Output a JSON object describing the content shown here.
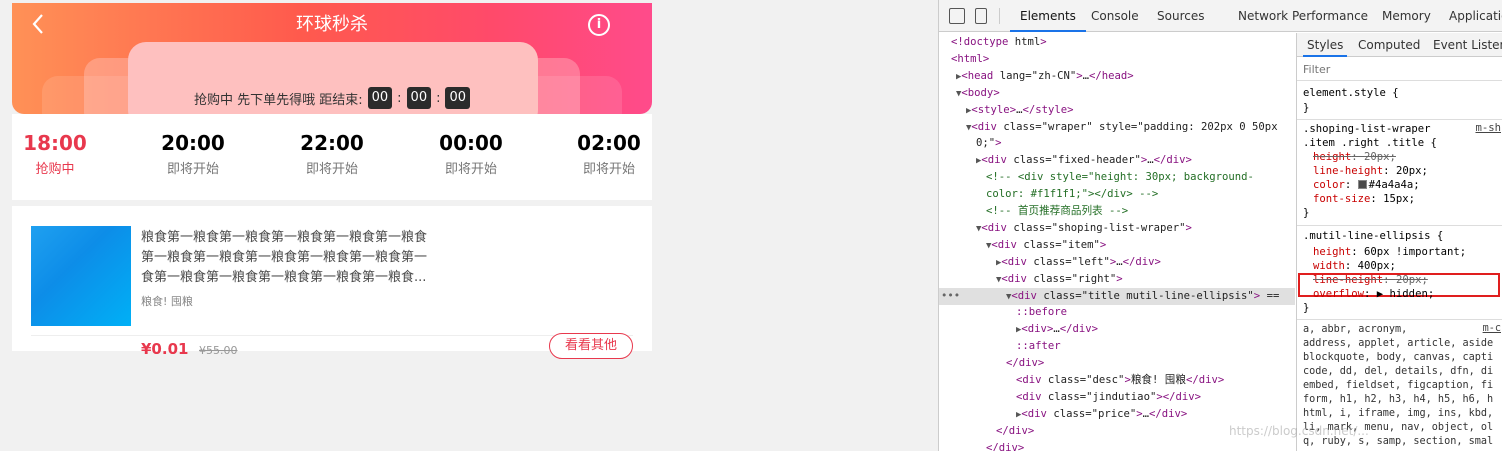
{
  "page": {
    "header": {
      "title": "环球秒杀",
      "back_icon": "chevron-left-icon",
      "info_icon": "info-icon"
    },
    "countdown": {
      "label": "抢购中 先下单先得哦 距结束:",
      "hours": "00",
      "minutes": "00",
      "seconds": "00",
      "separator": ":"
    },
    "time_slots": [
      {
        "time": "18:00",
        "status": "抢购中",
        "active": true
      },
      {
        "time": "20:00",
        "status": "即将开始",
        "active": false
      },
      {
        "time": "22:00",
        "status": "即将开始",
        "active": false
      },
      {
        "time": "00:00",
        "status": "即将开始",
        "active": false
      },
      {
        "time": "02:00",
        "status": "即将开始",
        "active": false
      }
    ],
    "product": {
      "title_lines": [
        "粮食第一粮食第一粮食第一粮食第一粮食第一粮食",
        "第一粮食第一粮食第一粮食第一粮食第一粮食第一",
        "食第一粮食第一粮食第一粮食第一粮食第一粮食..."
      ],
      "desc": "粮食! 囤粮",
      "price": "¥0.01",
      "old_price": "¥55.00",
      "button": "看看其他"
    },
    "colors": {
      "accent": "#e8384d",
      "header_start": "#ff9156",
      "header_end": "#ff4b8b"
    }
  },
  "devtools": {
    "tabs": [
      "Elements",
      "Console",
      "Sources",
      "Network",
      "Performance",
      "Memory",
      "Applicatio"
    ],
    "active_tab": "Elements",
    "dom_lines": [
      {
        "t": "<!doctype html>"
      },
      {
        "t": "<html>"
      },
      {
        "t": "▶<head lang=\"zh-CN\">…</head>"
      },
      {
        "t": "▼<body>"
      },
      {
        "t": "▶<style>…</style>"
      },
      {
        "t": "▼<div class=\"wraper\" style=\"padding: 202px 0 50px"
      },
      {
        "t": "0;\">"
      },
      {
        "t": "▶<div class=\"fixed-header\">…</div>"
      },
      {
        "t": "<!-- <div style=\"height: 30px; background-"
      },
      {
        "t": "color: #f1f1f1;\"></div> -->"
      },
      {
        "t": "<!-- 首页推荐商品列表 -->"
      },
      {
        "t": "▼<div class=\"shoping-list-wraper\">"
      },
      {
        "t": "▼<div class=\"item\">"
      },
      {
        "t": "▶<div class=\"left\">…</div>"
      },
      {
        "t": "▼<div class=\"right\">"
      },
      {
        "t": "▼<div class=\"title mutil-line-ellipsis\"> =="
      },
      {
        "t": "::before"
      },
      {
        "t": "▶<div>…</div>"
      },
      {
        "t": "::after"
      },
      {
        "t": "</div>"
      },
      {
        "t": "<div class=\"desc\">粮食! 囤粮</div>"
      },
      {
        "t": "<div class=\"jindutiao\"></div>"
      },
      {
        "t": "▶<div class=\"price\">…</div>"
      },
      {
        "t": "</div>"
      },
      {
        "t": "</div>"
      }
    ],
    "styles": {
      "tabs": [
        "Styles",
        "Computed",
        "Event Listene"
      ],
      "filter_placeholder": "Filter",
      "element_style": "element.style {",
      "rule1": {
        "selector_1": ".shoping-list-wraper",
        "selector_2": ".item .right .title {",
        "source": "m-sh",
        "props": [
          {
            "name": "height",
            "value": "20px;",
            "struck": true
          },
          {
            "name": "line-height",
            "value": "20px;",
            "struck": false
          },
          {
            "name": "color",
            "value": "#4a4a4a;",
            "struck": false
          },
          {
            "name": "font-size",
            "value": "15px;",
            "struck": false
          }
        ]
      },
      "rule2": {
        "selector": ".mutil-line-ellipsis {",
        "props": [
          {
            "name": "height",
            "value": "60px !important;",
            "struck": false
          },
          {
            "name": "width",
            "value": "400px;",
            "struck": false
          },
          {
            "name": "line-height",
            "value": "20px;",
            "struck": true
          },
          {
            "name": "overflow",
            "value": "▶ hidden;",
            "struck": false
          }
        ]
      },
      "ua_rule": {
        "source": "m-c",
        "lines": [
          "a, abbr, acronym,",
          "address, applet, article, aside",
          "blockquote, body, canvas, capti",
          "code, dd, del, details, dfn, di",
          "embed, fieldset, figcaption, fi",
          "form, h1, h2, h3, h4, h5, h6, h",
          "html, i, iframe, img, ins, kbd,",
          "li, mark, menu, nav, object, ol",
          "q, ruby, s, samp, section, smal"
        ]
      }
    },
    "watermark": "https://blog.csdn.net/..."
  }
}
